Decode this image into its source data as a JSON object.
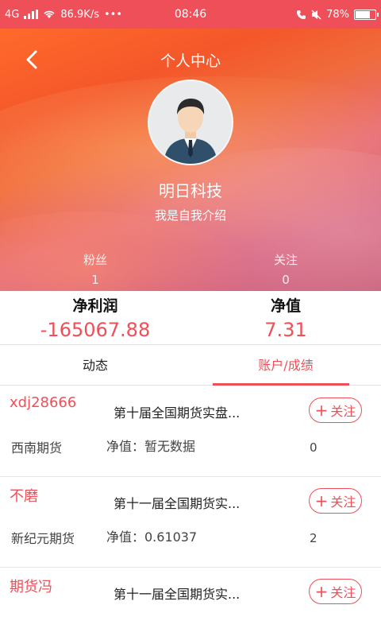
{
  "status_bar": {
    "network": "4G",
    "speed": "86.9K/s",
    "dots": "•••",
    "time": "08:46",
    "battery_text": "78%",
    "battery_level": 0.78
  },
  "header": {
    "title": "个人中心",
    "back_icon": "chevron-left-icon"
  },
  "profile": {
    "name": "明日科技",
    "intro": "我是自我介绍",
    "fans_label": "粉丝",
    "fans_count": "1",
    "follow_label": "关注",
    "follow_count": "0"
  },
  "metrics": {
    "profit_label": "净利润",
    "profit_value": "-165067.88",
    "nav_label": "净值",
    "nav_value": "7.31"
  },
  "tabs": [
    {
      "label": "动态",
      "active": false
    },
    {
      "label": "账户/成绩",
      "active": true
    }
  ],
  "accounts": [
    {
      "name": "xdj28666",
      "contest": "第十届全国期货实盘...",
      "broker": "西南期货",
      "nav": "净值：暂无数据",
      "count": "0",
      "follow_label": "关注"
    },
    {
      "name": "不磨",
      "contest": "第十一届全国期货实...",
      "broker": "新纪元期货",
      "nav": "净值：0.61037",
      "count": "2",
      "follow_label": "关注"
    },
    {
      "name": "期货冯",
      "contest": "第十一届全国期货实...",
      "broker": "",
      "nav": "",
      "count": "",
      "follow_label": "关注"
    }
  ],
  "colors": {
    "accent": "#ef4f58",
    "status_bar": "#ef4f58"
  }
}
